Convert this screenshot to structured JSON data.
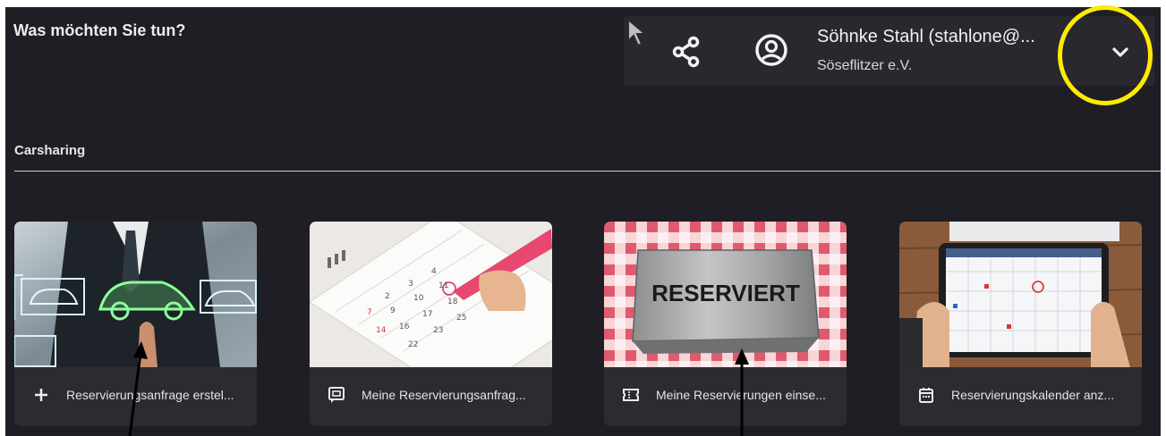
{
  "page": {
    "title": "Was möchten Sie tun?"
  },
  "account": {
    "user_name": "Söhnke Stahl (stahlone@...",
    "organization": "Söseflitzer e.V."
  },
  "section": {
    "title": "Carsharing"
  },
  "cards": [
    {
      "label": "Reservierungsanfrage erstel...",
      "icon": "plus-icon"
    },
    {
      "label": "Meine Reservierungsanfrag...",
      "icon": "message-icon"
    },
    {
      "label": "Meine Reservierungen einse...",
      "icon": "ticket-icon"
    },
    {
      "label": "Reservierungskalender anz...",
      "icon": "calendar-icon"
    }
  ],
  "images": {
    "card_3_sign": "RESERVIERT"
  },
  "colors": {
    "background": "#1f1e24",
    "card": "#2c2b31",
    "account_bar": "#29282e",
    "annotation": "#ffeb00"
  }
}
